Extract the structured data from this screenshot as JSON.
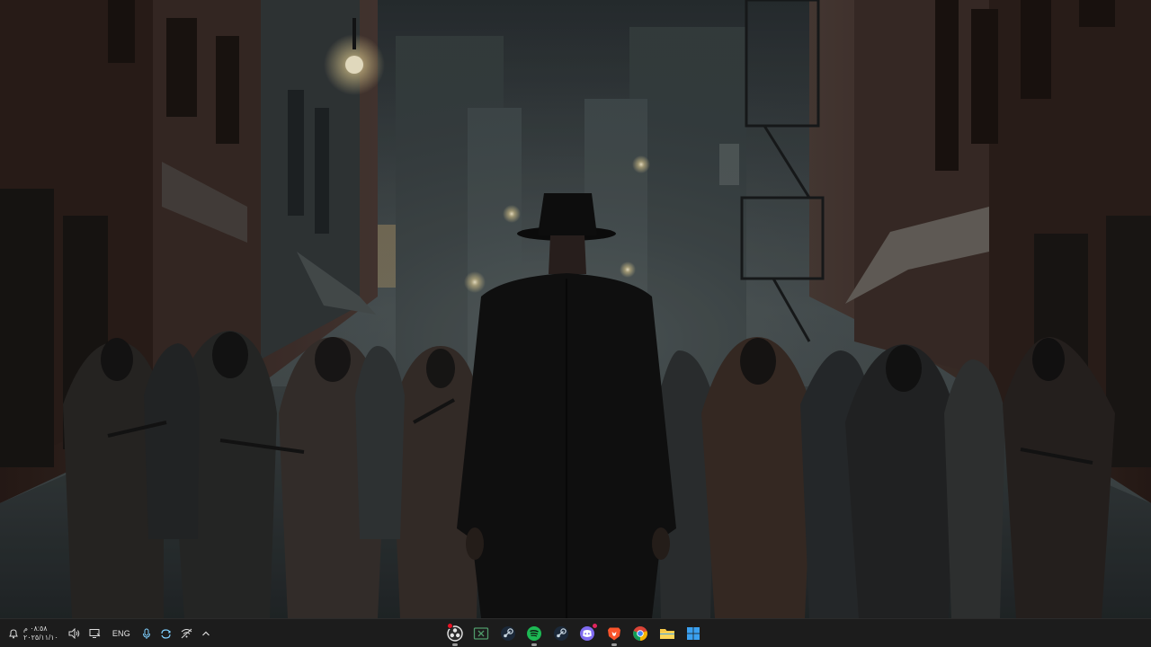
{
  "wallpaper": {
    "description_icon": "noir-alley-wallpaper"
  },
  "taskbar": {
    "clock": {
      "time": "٠٨:٥٨ م",
      "date": "٢٠٢٥/١١/١٠"
    },
    "language": "ENG",
    "tray_icons": [
      "notification-icon",
      "volume-icon",
      "display-icon",
      "microphone-icon",
      "sync-icon",
      "network-off-icon",
      "chevron-up-icon"
    ],
    "apps": [
      {
        "name": "obs-icon",
        "color": "#ffffff"
      },
      {
        "name": "xbox-game-bar-icon",
        "color": "#3c9a5f"
      },
      {
        "name": "steam-icon",
        "color": "#c6d4df"
      },
      {
        "name": "spotify-icon",
        "color": "#1db954"
      },
      {
        "name": "steam-icon-2",
        "color": "#c6d4df"
      },
      {
        "name": "discord-icon",
        "color": "#7f6bf0"
      },
      {
        "name": "brave-icon",
        "color": "#fb542b"
      },
      {
        "name": "chrome-icon",
        "color": "#4285f4"
      },
      {
        "name": "file-explorer-icon",
        "color": "#f7c948"
      },
      {
        "name": "start-icon",
        "color": "#3aa0f0"
      }
    ],
    "accent_color": "#1c1c1c"
  }
}
